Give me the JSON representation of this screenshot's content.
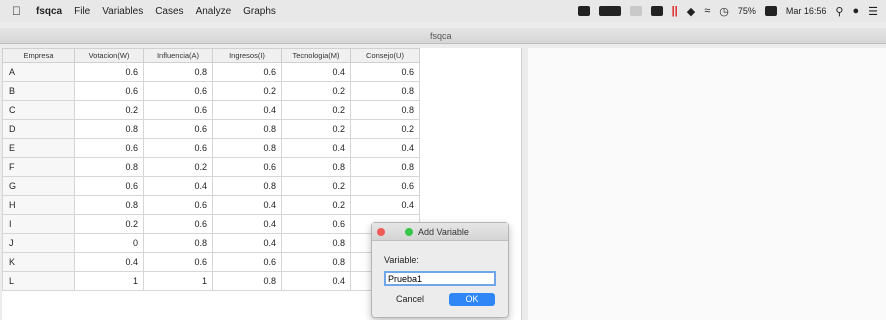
{
  "menubar": {
    "apple_icon": "",
    "app_name": "fsqca",
    "menus": [
      "File",
      "Variables",
      "Cases",
      "Analyze",
      "Graphs"
    ],
    "battery_percent": "75%",
    "clock": "Mar 16:56"
  },
  "window": {
    "title": "fsqca"
  },
  "table": {
    "columns": [
      "Empresa",
      "Votacion(W)",
      "Influencia(A)",
      "Ingresos(I)",
      "Tecnologia(M)",
      "Consejo(U)"
    ],
    "rows": [
      {
        "label": "A",
        "values": [
          "0.6",
          "0.8",
          "0.6",
          "0.4",
          "0.6"
        ]
      },
      {
        "label": "B",
        "values": [
          "0.6",
          "0.6",
          "0.2",
          "0.2",
          "0.8"
        ]
      },
      {
        "label": "C",
        "values": [
          "0.2",
          "0.6",
          "0.4",
          "0.2",
          "0.8"
        ]
      },
      {
        "label": "D",
        "values": [
          "0.8",
          "0.6",
          "0.8",
          "0.2",
          "0.2"
        ]
      },
      {
        "label": "E",
        "values": [
          "0.6",
          "0.6",
          "0.8",
          "0.4",
          "0.4"
        ]
      },
      {
        "label": "F",
        "values": [
          "0.8",
          "0.2",
          "0.6",
          "0.8",
          "0.8"
        ]
      },
      {
        "label": "G",
        "values": [
          "0.6",
          "0.4",
          "0.8",
          "0.2",
          "0.6"
        ]
      },
      {
        "label": "H",
        "values": [
          "0.8",
          "0.6",
          "0.4",
          "0.2",
          "0.4"
        ]
      },
      {
        "label": "I",
        "values": [
          "0.2",
          "0.6",
          "0.4",
          "0.6",
          ""
        ]
      },
      {
        "label": "J",
        "values": [
          "0",
          "0.8",
          "0.4",
          "0.8",
          ""
        ]
      },
      {
        "label": "K",
        "values": [
          "0.4",
          "0.6",
          "0.6",
          "0.8",
          ""
        ]
      },
      {
        "label": "L",
        "values": [
          "1",
          "1",
          "0.8",
          "0.4",
          ""
        ]
      }
    ]
  },
  "dialog": {
    "title": "Add Variable",
    "field_label": "Variable:",
    "field_value": "Prueba1",
    "cancel_label": "Cancel",
    "ok_label": "OK"
  }
}
